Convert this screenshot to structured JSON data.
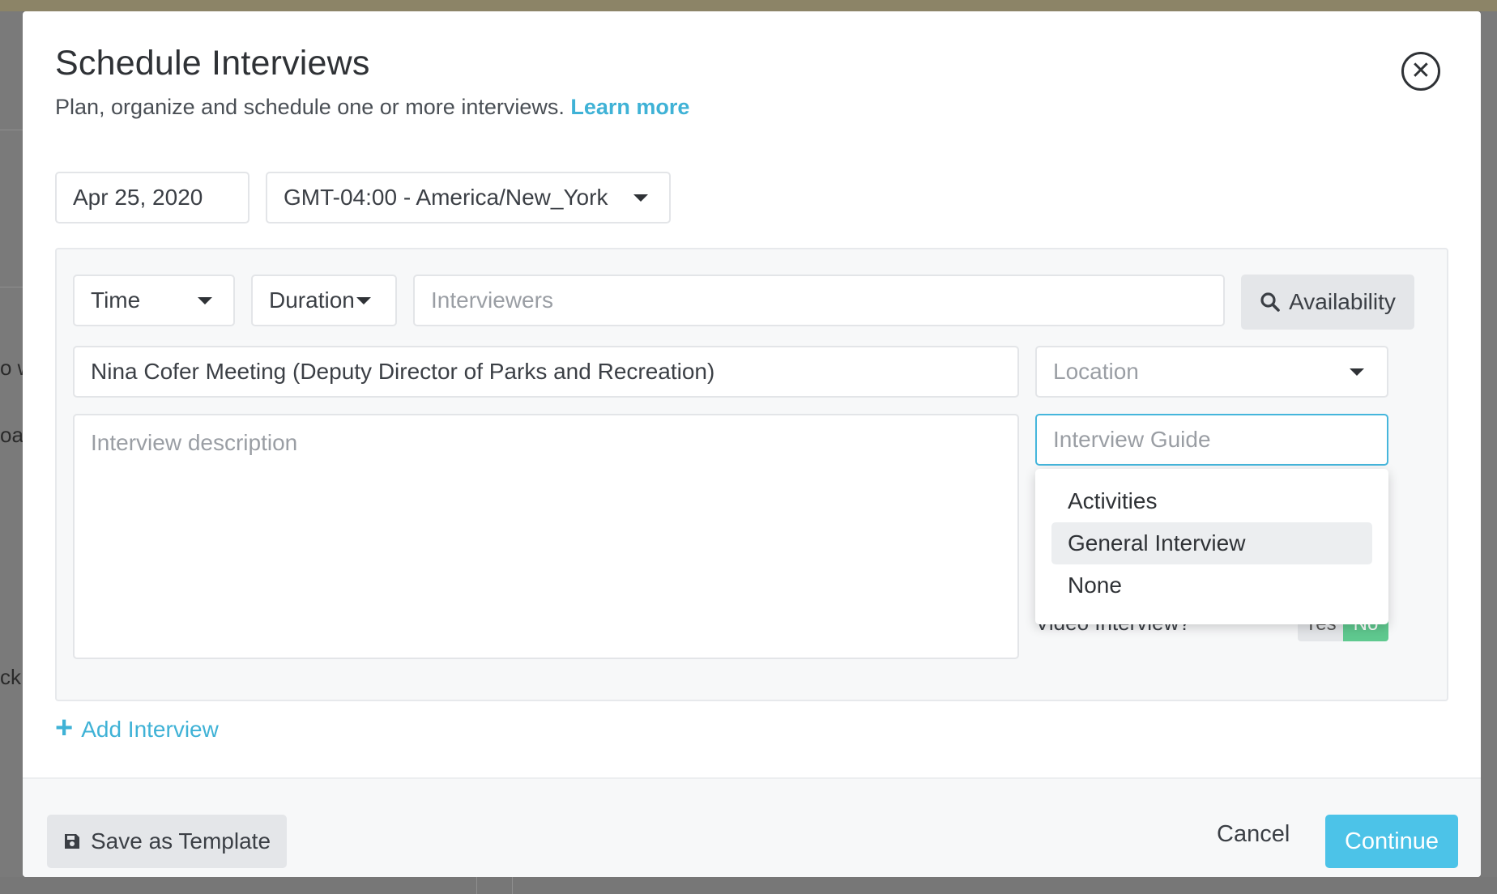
{
  "modal": {
    "title": "Schedule Interviews",
    "subtitle": "Plan, organize and schedule one or more interviews.",
    "learn_more": "Learn more",
    "close_icon": "close-circle-icon"
  },
  "date_field": {
    "value": "Apr 25, 2020"
  },
  "timezone_select": {
    "value": "GMT-04:00 - America/New_York"
  },
  "interview": {
    "time_select": "Time",
    "duration_select": "Duration",
    "interviewers_placeholder": "Interviewers",
    "availability_label": "Availability",
    "title_value": "Nina Cofer Meeting (Deputy Director of Parks and Recreation)",
    "location_placeholder": "Location",
    "description_placeholder": "Interview description",
    "guide_placeholder": "Interview Guide",
    "guide_options": [
      "Activities",
      "General Interview",
      "None"
    ],
    "guide_highlighted": "General Interview",
    "video_label": "Video Interview?",
    "video_yes": "Yes",
    "video_no": "No"
  },
  "add_interview": "Add Interview",
  "footer": {
    "save_template": "Save as Template",
    "cancel": "Cancel",
    "continue": "Continue"
  },
  "background_fragments": [
    "o w",
    "oals",
    "ck A"
  ],
  "colors": {
    "accent": "#3fb2d6",
    "continue_button": "#4cc3e8",
    "toggle_no": "#5fc98f",
    "focus_border": "#45b6dc"
  }
}
